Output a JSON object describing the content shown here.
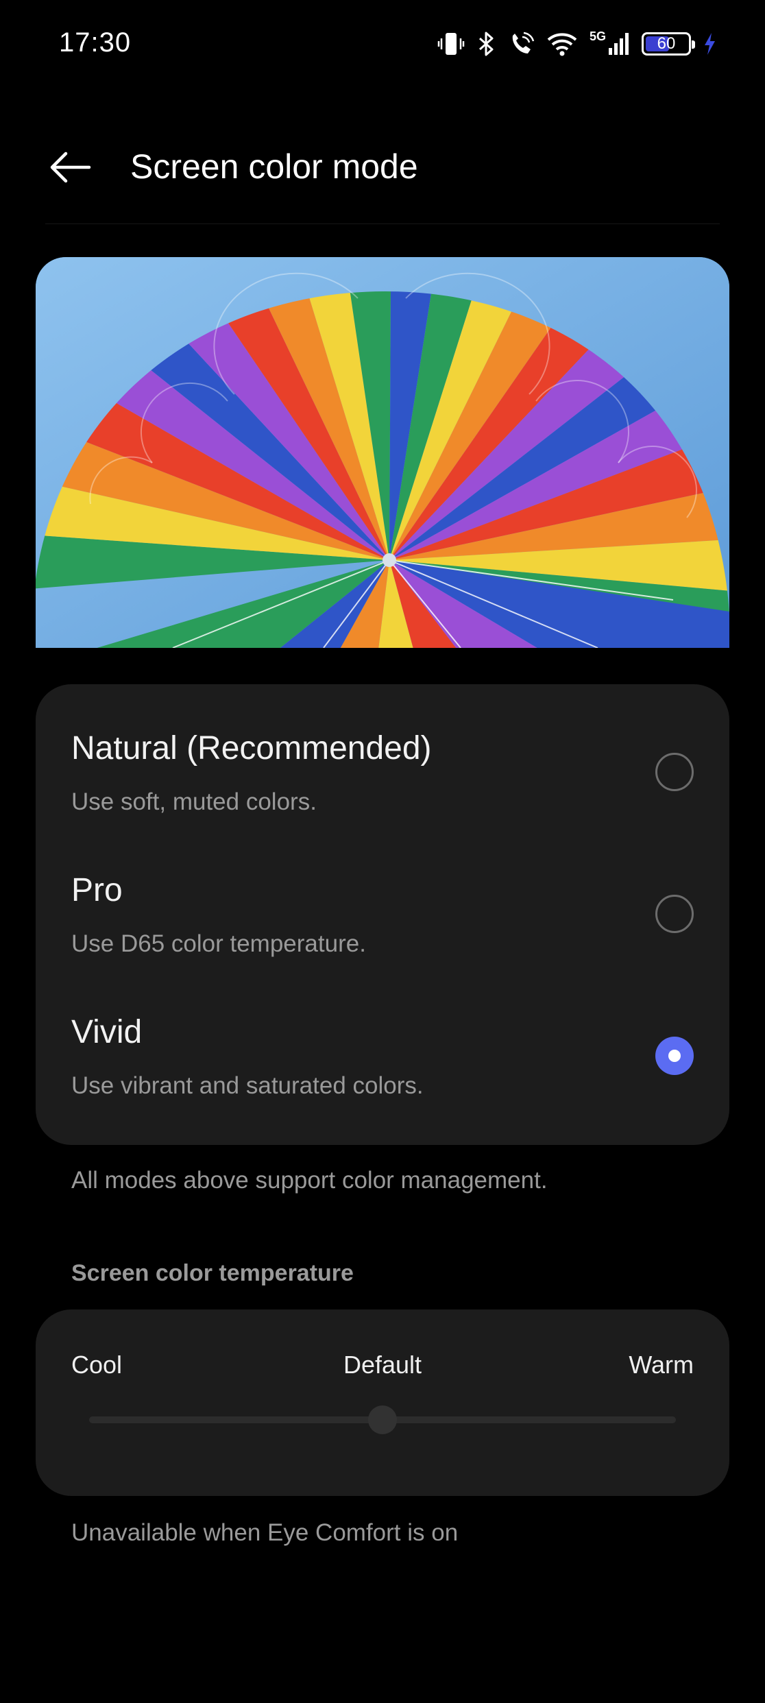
{
  "status_bar": {
    "time": "17:30",
    "network": "5G",
    "battery_level": "60",
    "icons": [
      "vibrate-icon",
      "bluetooth-icon",
      "wifi-calling-icon",
      "wifi-icon",
      "cellular-signal-icon",
      "battery-icon",
      "charging-icon"
    ]
  },
  "header": {
    "back_icon": "arrow-left-icon",
    "title": "Screen color mode"
  },
  "modes": [
    {
      "title": "Natural (Recommended)",
      "subtitle": "Use soft, muted colors.",
      "selected": false
    },
    {
      "title": "Pro",
      "subtitle": "Use D65 color temperature.",
      "selected": false
    },
    {
      "title": "Vivid",
      "subtitle": "Use vibrant and saturated colors.",
      "selected": true
    }
  ],
  "modes_note": "All modes above support color management.",
  "temperature": {
    "section_label": "Screen color temperature",
    "cool_label": "Cool",
    "default_label": "Default",
    "warm_label": "Warm",
    "value_fraction": 0.5,
    "note": "Unavailable when Eye Comfort is on"
  },
  "colors": {
    "background": "#000000",
    "card": "#1c1c1c",
    "accent": "#5b6cf2",
    "secondary_text": "#9a9a9a"
  }
}
